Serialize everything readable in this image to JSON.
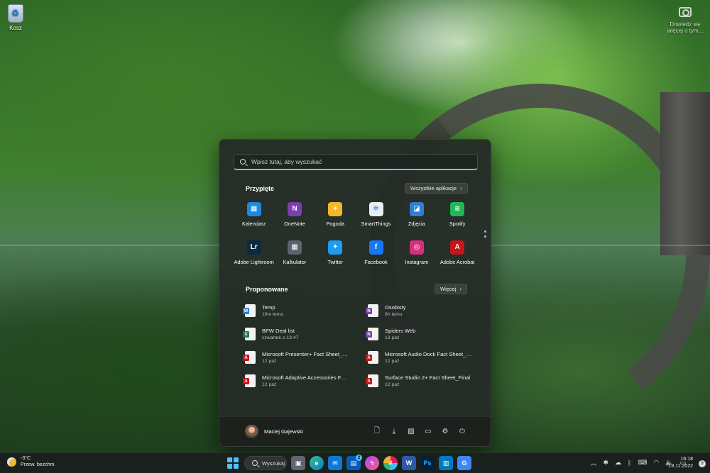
{
  "desktop": {
    "recycle_bin_label": "Kosz",
    "screenshot_label": "Dowiedz się więcej o tym..."
  },
  "start_menu": {
    "search_placeholder": "Wpisz tutaj, aby wyszukać",
    "pinned_title": "Przypięte",
    "all_apps_label": "Wszystkie aplikacje",
    "pinned_apps": [
      {
        "label": "Kalendarz",
        "icon": "calendar-icon",
        "color": "#1e88e5",
        "glyph": "▦"
      },
      {
        "label": "OneNote",
        "icon": "onenote-icon",
        "color": "#7b3fb0",
        "glyph": "N"
      },
      {
        "label": "Pogoda",
        "icon": "weather-icon",
        "color": "#f4b72b",
        "glyph": "☀"
      },
      {
        "label": "SmartThings",
        "icon": "smartthings-icon",
        "color": "#e9eef3",
        "glyph": "✲"
      },
      {
        "label": "Zdjęcia",
        "icon": "photos-icon",
        "color": "#2f7fd6",
        "glyph": "◪"
      },
      {
        "label": "Spotify",
        "icon": "spotify-icon",
        "color": "#1db954",
        "glyph": "≋"
      },
      {
        "label": "Adobe Lightroom",
        "icon": "lightroom-icon",
        "color": "#0b2a3f",
        "glyph": "Lr"
      },
      {
        "label": "Kalkulator",
        "icon": "calculator-icon",
        "color": "#5a6470",
        "glyph": "▦"
      },
      {
        "label": "Twitter",
        "icon": "twitter-icon",
        "color": "#1d9bf0",
        "glyph": "✦"
      },
      {
        "label": "Facebook",
        "icon": "facebook-icon",
        "color": "#1877f2",
        "glyph": "f"
      },
      {
        "label": "Instagram",
        "icon": "instagram-icon",
        "color": "#d6307b",
        "glyph": "◎"
      },
      {
        "label": "Adobe Acrobat",
        "icon": "acrobat-icon",
        "color": "#c4161c",
        "glyph": "A"
      }
    ],
    "recommended_title": "Proponowane",
    "more_label": "Więcej",
    "recommended": [
      {
        "name": "Temp",
        "time": "19m temu",
        "type": "word",
        "tag_color": "#2b7cd3",
        "tag": "W"
      },
      {
        "name": "Osobisty",
        "time": "8h temu",
        "type": "onenote",
        "tag_color": "#7b3fb0",
        "tag": "N"
      },
      {
        "name": "BFW Deal list",
        "time": "czwartek o 13:47",
        "type": "excel",
        "tag_color": "#1f7a43",
        "tag": "X"
      },
      {
        "name": "Spiders Web",
        "time": "13 paź",
        "type": "onenote",
        "tag_color": "#7b3fb0",
        "tag": "N"
      },
      {
        "name": "Microsoft Presenter+ Fact Sheet_Fi...",
        "time": "12 paź",
        "type": "pdf",
        "tag_color": "#c4161c",
        "tag": "A"
      },
      {
        "name": "Microsoft Audio Dock Fact Sheet_Fi...",
        "time": "12 paź",
        "type": "pdf",
        "tag_color": "#c4161c",
        "tag": "A"
      },
      {
        "name": "Microsoft Adaptive Accessories Fac...",
        "time": "12 paź",
        "type": "pdf",
        "tag_color": "#c4161c",
        "tag": "A"
      },
      {
        "name": "Surface Studio 2+ Fact Sheet_Final",
        "time": "12 paź",
        "type": "pdf",
        "tag_color": "#c4161c",
        "tag": "A"
      }
    ],
    "user_name": "Maciej Gajewski"
  },
  "taskbar": {
    "weather_temp": "-3°C",
    "weather_desc": "Przew. bezchm.",
    "search_label": "Wyszukaj",
    "mail_badge": "2",
    "time": "16:18",
    "date": "19.11.2022",
    "notification_count": "9"
  }
}
